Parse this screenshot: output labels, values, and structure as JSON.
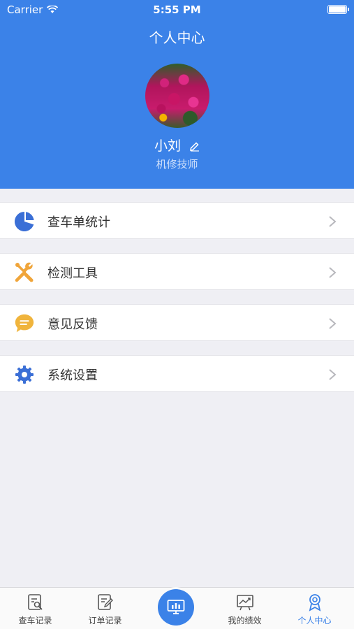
{
  "status_bar": {
    "carrier": "Carrier",
    "time": "5:55 PM"
  },
  "header": {
    "title": "个人中心",
    "user_name": "小刘",
    "user_role": "机修技师",
    "color": "#3b82e8"
  },
  "menu": [
    {
      "label": "查车单统计",
      "icon": "pie-chart-icon",
      "color": "#3b6fd6"
    },
    {
      "label": "检测工具",
      "icon": "tools-icon",
      "color": "#f0a53a"
    },
    {
      "label": "意见反馈",
      "icon": "chat-bubble-icon",
      "color": "#f0b43c"
    },
    {
      "label": "系统设置",
      "icon": "gear-icon",
      "color": "#3b6fd6"
    }
  ],
  "tabbar": {
    "tabs": [
      {
        "label": "查车记录",
        "icon": "search-document-icon"
      },
      {
        "label": "订单记录",
        "icon": "edit-document-icon"
      },
      {
        "label": "",
        "icon": "monitor-chart-icon"
      },
      {
        "label": "我的绩效",
        "icon": "trend-chart-icon"
      },
      {
        "label": "个人中心",
        "icon": "person-badge-icon",
        "active": true
      }
    ],
    "active_color": "#3b82e8"
  }
}
